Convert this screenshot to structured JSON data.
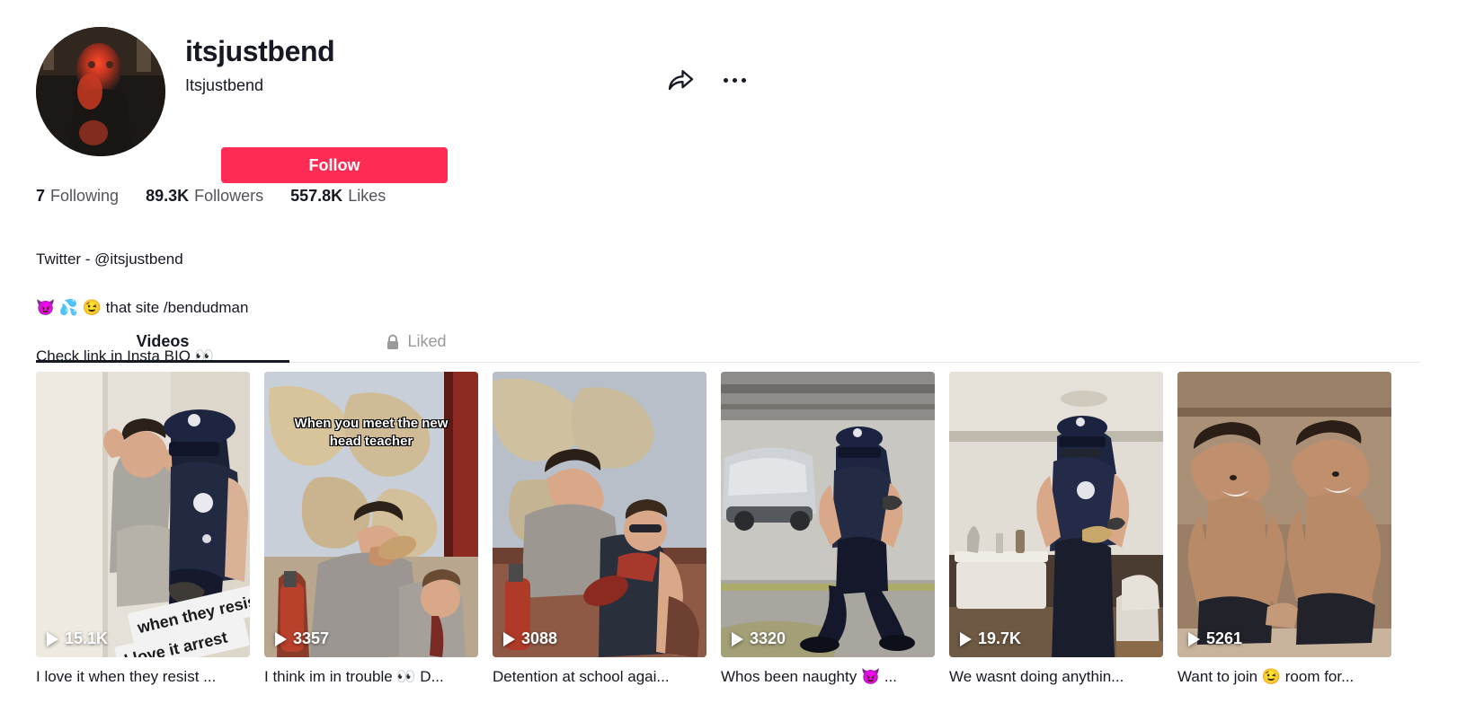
{
  "profile": {
    "username": "itsjustbend",
    "nickname": "Itsjustbend",
    "follow_label": "Follow",
    "avatar_alt": "avatar",
    "share_icon": "share-arrow-icon",
    "more_icon": "more-options-icon"
  },
  "stats": [
    {
      "value": "7",
      "label": "Following"
    },
    {
      "value": "89.3K",
      "label": "Followers"
    },
    {
      "value": "557.8K",
      "label": "Likes"
    }
  ],
  "bio": {
    "line1": "Twitter - @itsjustbend",
    "line2": "😈 💦 😉 that site /bendudman",
    "line3": "Check link in Insta BIO 👀"
  },
  "tabs": [
    {
      "label": "Videos",
      "active": true,
      "locked": false
    },
    {
      "label": "Liked",
      "active": false,
      "locked": true
    }
  ],
  "videos": [
    {
      "views": "15.1K",
      "caption": "I love it when they resist ...",
      "overlay": "",
      "palette": {
        "bg": "#d9d2c8",
        "mid": "#8a8378",
        "dark": "#232430",
        "accent": "#1d2333"
      }
    },
    {
      "views": "3357",
      "caption": "I think im in trouble 👀 D...",
      "overlay": "When you meet the new head teacher",
      "palette": {
        "bg": "#b9bfc6",
        "mid": "#9a8f7f",
        "dark": "#6d4038",
        "accent": "#8c2d22"
      }
    },
    {
      "views": "3088",
      "caption": "Detention at school agai...",
      "overlay": "",
      "palette": {
        "bg": "#a9b2bd",
        "mid": "#8e8272",
        "dark": "#5c3029",
        "accent": "#7d3a2c"
      }
    },
    {
      "views": "3320",
      "caption": "Whos been naughty 😈 ...",
      "overlay": "",
      "palette": {
        "bg": "#b3b2ae",
        "mid": "#87867f",
        "dark": "#2a2b31",
        "accent": "#9a9a3c"
      }
    },
    {
      "views": "19.7K",
      "caption": "We wasnt doing anythin...",
      "overlay": "",
      "palette": {
        "bg": "#cfc8bd",
        "mid": "#8e8578",
        "dark": "#2b2c38",
        "accent": "#3a3b4a"
      }
    },
    {
      "views": "5261",
      "caption": "Want to join 😉 room for...",
      "overlay": "",
      "palette": {
        "bg": "#b9a696",
        "mid": "#9b7f6a",
        "dark": "#4a3a30",
        "accent": "#2a2520"
      }
    }
  ],
  "colors": {
    "brand_red": "#FE2C55",
    "text_primary": "#161823",
    "text_muted": "#9a9a9c",
    "divider": "#e9e9ea"
  }
}
